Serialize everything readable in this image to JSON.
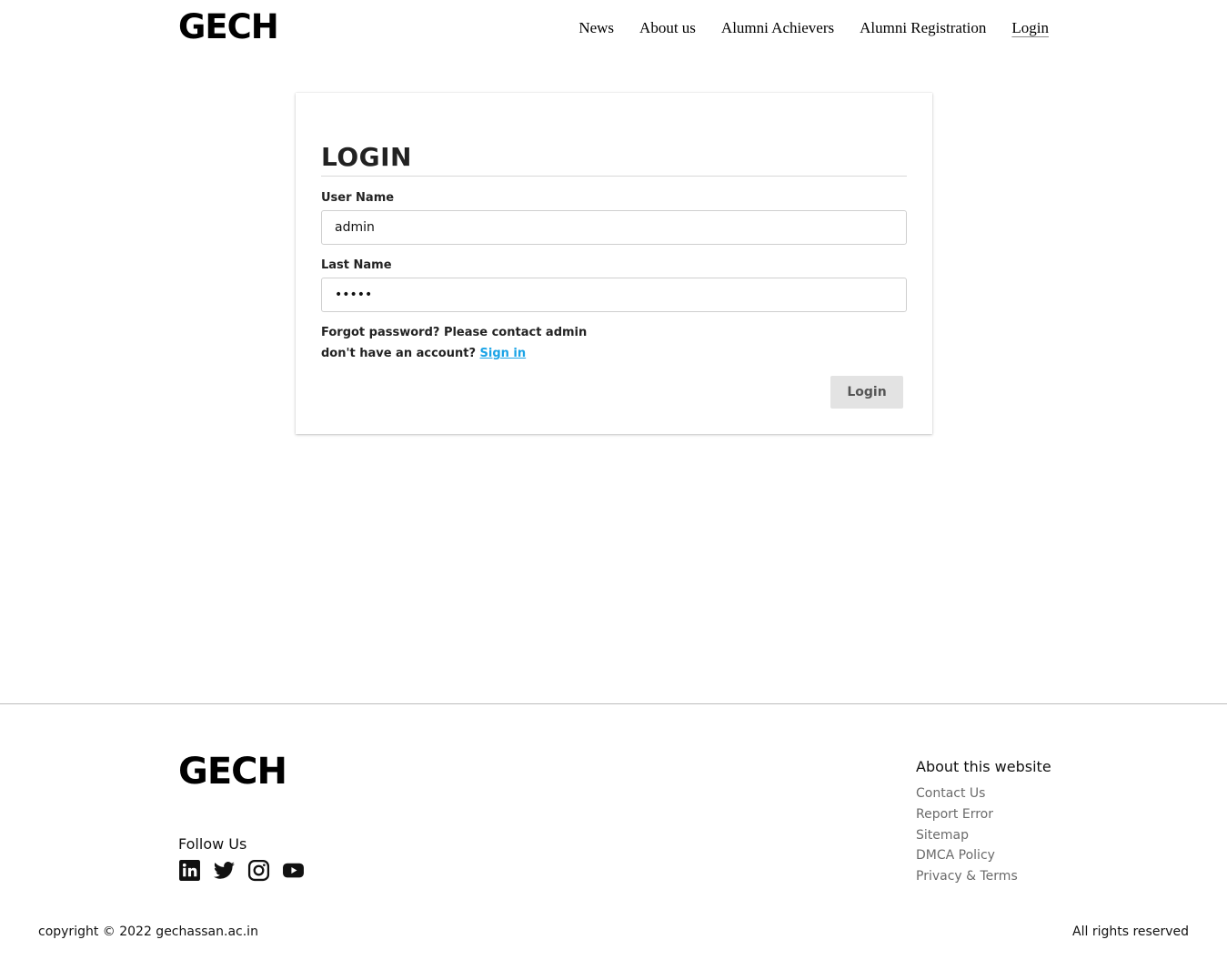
{
  "header": {
    "logo": "GECH",
    "nav": [
      {
        "label": "News"
      },
      {
        "label": "About us"
      },
      {
        "label": "Alumni Achievers"
      },
      {
        "label": "Alumni Registration"
      },
      {
        "label": "Login",
        "active": true
      }
    ]
  },
  "login": {
    "title": "LOGIN",
    "username_label": "User Name",
    "username_value": "admin",
    "password_label": "Last Name",
    "password_value": "•••••",
    "forgot_text": "Forgot password? Please contact admin",
    "account_text": "don't have an account? ",
    "signin_link": "Sign in",
    "submit_label": "Login",
    "link_color": "#1aa3e6"
  },
  "footer": {
    "logo": "GECH",
    "follow_title": "Follow Us",
    "social_icons": [
      "linkedin-icon",
      "twitter-icon",
      "instagram-icon",
      "youtube-icon"
    ],
    "about_title": "About this website",
    "about_links": [
      "Contact Us",
      "Report Error",
      "Sitemap",
      "DMCA Policy",
      "Privacy & Terms"
    ],
    "copyright": "copyright © 2022 gechassan.ac.in",
    "rights": "All rights reserved"
  }
}
